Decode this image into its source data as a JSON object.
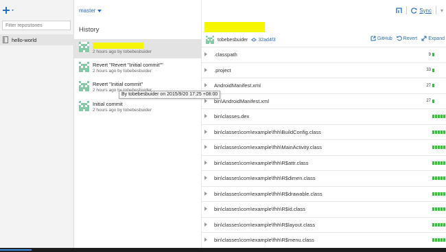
{
  "sidebar": {
    "filter_placeholder": "Filter repositories",
    "repos": [
      {
        "label": "hello-world"
      }
    ]
  },
  "history": {
    "branch": "master",
    "title": "History",
    "commits": [
      {
        "title": "",
        "meta": "2 hours ago by tobebesbuider",
        "selected": true
      },
      {
        "title": "Revert \"Revert \"Initial commit\"\"",
        "meta": "2 hours ago by tobebesbuider"
      },
      {
        "title": "Revert \"Initial commit\"",
        "meta": "2 hours ago by tobebesbuider"
      },
      {
        "title": "Initial commit",
        "meta": "2 hours ago by tobebesbuider"
      }
    ],
    "tooltip": "By tobebesbuider on 2015/9/20 17:25 +08:00"
  },
  "toolbar": {
    "sync_label": "Sync",
    "github_label": "GitHub",
    "revert_label": "Revert",
    "expand_label": "Expand"
  },
  "commit_detail": {
    "author": "tobebesbuider",
    "sha": "32ad4f3"
  },
  "files": [
    {
      "path": ".classpath",
      "count": "9"
    },
    {
      "path": ".project",
      "count": "33"
    },
    {
      "path": "AndroidManifest.xml",
      "count": "27"
    },
    {
      "path": "bin\\AndroidManifest.xml",
      "count": "27"
    },
    {
      "path": "bin\\classes.dex",
      "count": ""
    },
    {
      "path": "bin\\classes\\com\\example\\fhh\\BuildConfig.class",
      "count": ""
    },
    {
      "path": "bin\\classes\\com\\example\\fhh\\MainActivity.class",
      "count": ""
    },
    {
      "path": "bin\\classes\\com\\example\\fhh\\R$attr.class",
      "count": ""
    },
    {
      "path": "bin\\classes\\com\\example\\fhh\\R$dimen.class",
      "count": ""
    },
    {
      "path": "bin\\classes\\com\\example\\fhh\\R$drawable.class",
      "count": ""
    },
    {
      "path": "bin\\classes\\com\\example\\fhh\\R$id.class",
      "count": ""
    },
    {
      "path": "bin\\classes\\com\\example\\fhh\\R$layout.class",
      "count": ""
    },
    {
      "path": "bin\\classes\\com\\example\\fhh\\R$menu.class",
      "count": ""
    }
  ],
  "colors": {
    "accent": "#2a6db5",
    "highlight": "#f6f600",
    "diff_bar": "#44b549"
  },
  "icons": {
    "add": "plus-icon",
    "repo": "repo-icon",
    "avatar": "identicon",
    "sync": "sync-icon",
    "github": "external-link-icon",
    "revert": "revert-icon",
    "expand": "expand-icon",
    "sha": "commit-icon"
  }
}
